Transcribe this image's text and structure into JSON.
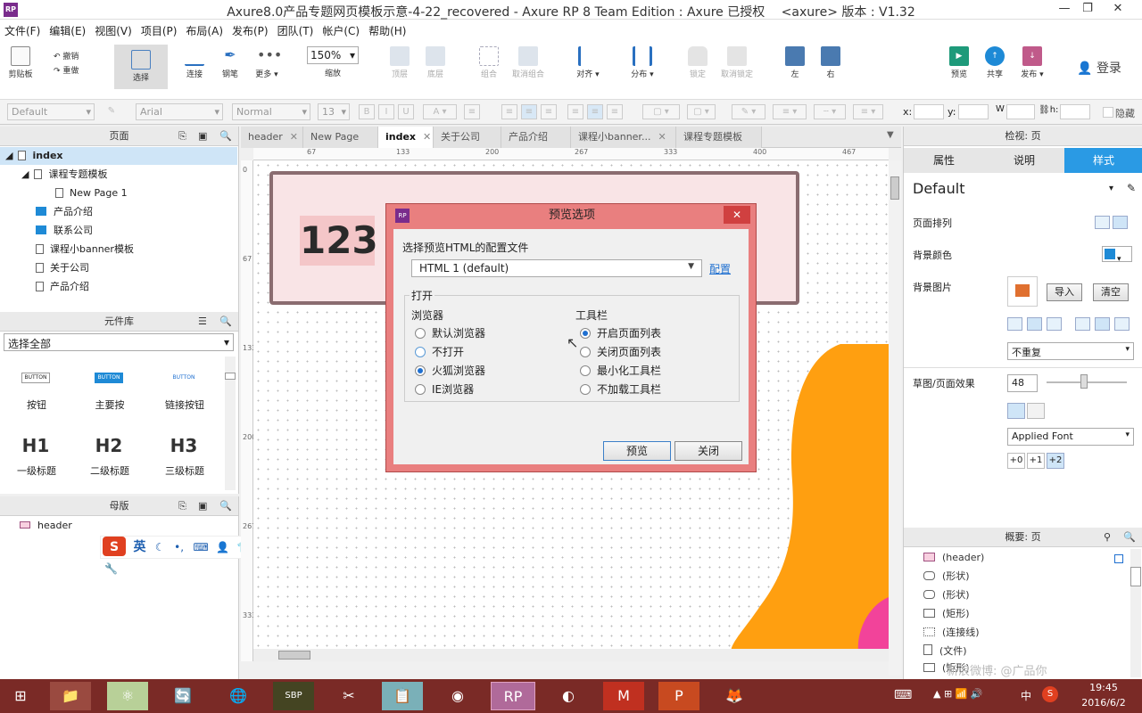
{
  "window": {
    "title": "Axure8.0产品专题网页模板示意-4-22_recovered - Axure RP 8 Team Edition : Axure 已授权　 <axure> 版本 : V1.32",
    "logo": "RP",
    "controls": [
      "—",
      "❐",
      "✕"
    ]
  },
  "menu": [
    "文件(F)",
    "编辑(E)",
    "视图(V)",
    "项目(P)",
    "布局(A)",
    "发布(P)",
    "团队(T)",
    "帐户(C)",
    "帮助(H)"
  ],
  "toolbar": {
    "clipboard": "剪贴板",
    "undo": "撤销",
    "redo": "重做",
    "select": "选择",
    "connect": "连接",
    "pen": "钢笔",
    "more": "更多 ▾",
    "zoom": "150%",
    "zoom_label": "缩放",
    "top": "顶层",
    "bottom": "底层",
    "group": "组合",
    "ungroup": "取消组合",
    "align": "对齐 ▾",
    "distribute": "分布 ▾",
    "lock": "锁定",
    "unlock": "取消锁定",
    "left": "左",
    "right": "右",
    "preview": "预览",
    "share": "共享",
    "publish": "发布 ▾",
    "login": "登录"
  },
  "format_bar": {
    "style": "Default",
    "font": "Arial",
    "weight": "Normal",
    "size": "13",
    "x_label": "x:",
    "y_label": "y:",
    "w_label": "W",
    "h_label": "h:",
    "hidden": "隐藏"
  },
  "pages_panel": {
    "title": "页面",
    "items": [
      {
        "label": "index",
        "type": "page",
        "level": 0,
        "selected": true
      },
      {
        "label": "课程专题模板",
        "type": "page",
        "level": 1
      },
      {
        "label": "New Page 1",
        "type": "page",
        "level": 2
      },
      {
        "label": "产品介绍",
        "type": "folder",
        "level": 1
      },
      {
        "label": "联系公司",
        "type": "folder",
        "level": 1
      },
      {
        "label": "课程小banner模板",
        "type": "page",
        "level": 1
      },
      {
        "label": "关于公司",
        "type": "page",
        "level": 1
      },
      {
        "label": "产品介绍",
        "type": "page",
        "level": 1
      }
    ]
  },
  "library_panel": {
    "title": "元件库",
    "filter": "选择全部",
    "widgets": [
      {
        "preview": "BUTTON",
        "label": "按钮"
      },
      {
        "preview": "BUTTON",
        "label": "主要按"
      },
      {
        "preview": "BUTTON",
        "label": "链接按钮"
      },
      {
        "preview": "H1",
        "label": "一级标题"
      },
      {
        "preview": "H2",
        "label": "二级标题"
      },
      {
        "preview": "H3",
        "label": "三级标题"
      }
    ]
  },
  "masters_panel": {
    "title": "母版",
    "items": [
      "header"
    ]
  },
  "ime_bar": {
    "logo": "S",
    "mode": "英",
    "icons": [
      "☾",
      "•,",
      "⌨",
      "👤",
      "👕",
      "🔧"
    ]
  },
  "tabs": [
    {
      "label": "header",
      "active": false
    },
    {
      "label": "New Page 1",
      "active": false
    },
    {
      "label": "index",
      "active": true
    },
    {
      "label": "关于公司",
      "active": false
    },
    {
      "label": "产品介绍",
      "active": false
    },
    {
      "label": "课程小banner...",
      "active": false
    },
    {
      "label": "课程专题模板",
      "active": false
    }
  ],
  "ruler": {
    "h": [
      "67",
      "133",
      "200",
      "267",
      "333",
      "400",
      "467"
    ],
    "v": [
      "0",
      "67",
      "133",
      "200",
      "267",
      "333"
    ]
  },
  "canvas": {
    "box_text": "123"
  },
  "dialog": {
    "title": "预览选项",
    "config_label": "选择预览HTML的配置文件",
    "config_value": "HTML 1 (default)",
    "config_link": "配置",
    "group_label": "打开",
    "browser_label": "浏览器",
    "browsers": [
      {
        "label": "默认浏览器",
        "checked": false
      },
      {
        "label": "不打开",
        "checked": false
      },
      {
        "label": "火狐浏览器",
        "checked": true
      },
      {
        "label": "IE浏览器",
        "checked": false
      }
    ],
    "toolbar_label": "工具栏",
    "toolbars": [
      {
        "label": "开启页面列表",
        "checked": true
      },
      {
        "label": "关闭页面列表",
        "checked": false
      },
      {
        "label": "最小化工具栏",
        "checked": false
      },
      {
        "label": "不加载工具栏",
        "checked": false
      }
    ],
    "preview_button": "预览",
    "close_button": "关闭"
  },
  "inspector": {
    "title": "检视: 页",
    "tabs": [
      "属性",
      "说明",
      "样式"
    ],
    "style_name": "Default",
    "page_align": "页面排列",
    "bg_color": "背景颜色",
    "bg_image": "背景图片",
    "import": "导入",
    "clear": "清空",
    "repeat": "不重复",
    "sketch": "草图/页面效果",
    "sketch_value": "48",
    "font": "Applied Font",
    "font_steps": [
      "+0",
      "+1",
      "+2"
    ]
  },
  "outline": {
    "title": "概要: 页",
    "items": [
      "(header)",
      "(形状)",
      "(形状)",
      "(矩形)",
      "(连接线)",
      "(文件)",
      "(矩形)"
    ]
  },
  "watermark": "新浪微博: @广品你",
  "taskbar": {
    "time": "19:45",
    "date": "2016/6/2",
    "ime": "中",
    "apps": [
      "⊞",
      "📁",
      "⚛",
      "🔄",
      "🌐",
      "SBP",
      "✂",
      "📋",
      "◉",
      "RP",
      "◐",
      "M",
      "P",
      "🦊"
    ]
  }
}
